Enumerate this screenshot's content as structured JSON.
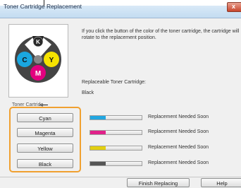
{
  "window": {
    "title": "Toner Cartridge Replacement"
  },
  "info_text": "If you click the button of the color of the toner cartridge, the cartridge will rotate to the replacement position.",
  "replaceable": {
    "label": "Replaceable Toner Cartridge:",
    "value": "Black"
  },
  "group_label": "Toner Cartridg",
  "drum": {
    "labels": {
      "k": "K",
      "c": "C",
      "y": "Y",
      "m": "M"
    },
    "colors": {
      "k": "#2a2a2a",
      "c": "#1aa7e0",
      "y": "#f6e300",
      "m": "#e3007f",
      "body": "#555555"
    }
  },
  "cartridges": [
    {
      "button": "Cyan",
      "status": "Replacement Needed Soon",
      "level": 0.3,
      "color": "#22a6e0"
    },
    {
      "button": "Magenta",
      "status": "Replacement Needed Soon",
      "level": 0.3,
      "color": "#e0218a"
    },
    {
      "button": "Yellow",
      "status": "Replacement Needed Soon",
      "level": 0.3,
      "color": "#e2cf10"
    },
    {
      "button": "Black",
      "status": "Replacement Needed Soon",
      "level": 0.3,
      "color": "#555555"
    }
  ],
  "footer": {
    "finish_label": "Finish Replacing",
    "help_label": "Help"
  },
  "highlight_color": "#f0a030"
}
